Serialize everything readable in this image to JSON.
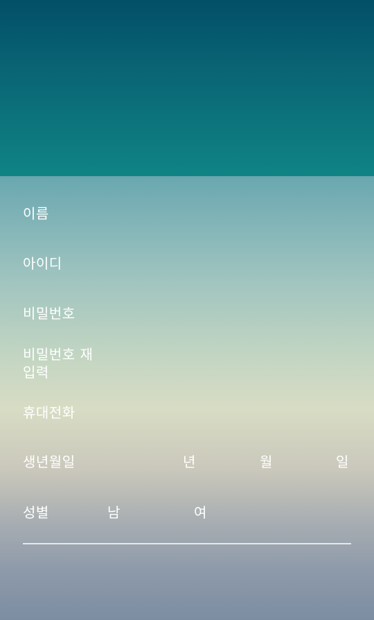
{
  "form": {
    "name_label": "이름",
    "id_label": "아이디",
    "password_label": "비밀번호",
    "password_confirm_label": "비밀번호 재입력",
    "phone_label": "휴대전화",
    "birth_label": "생년월일",
    "birth_year_unit": "년",
    "birth_month_unit": "월",
    "birth_day_unit": "일",
    "gender_label": "성별",
    "gender_male": "남",
    "gender_female": "여"
  },
  "colors": {
    "header": "#0a6775",
    "text": "#ffffff"
  }
}
